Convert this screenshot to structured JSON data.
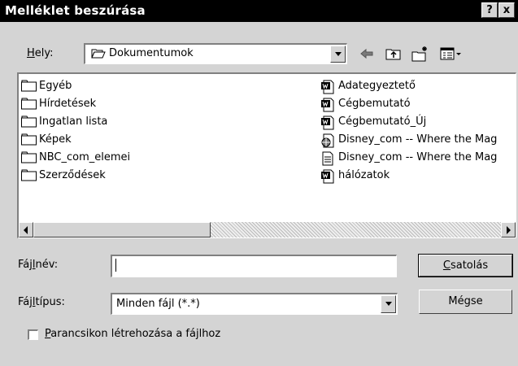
{
  "title": "Melléklet beszúrása",
  "title_buttons": {
    "help": "?",
    "close": "x"
  },
  "location": {
    "label_pre": "",
    "label_acc": "H",
    "label_post": "ely:",
    "value": "Dokumentumok"
  },
  "toolbar": {
    "back_icon": "arrow-left-icon",
    "up_icon": "up-folder-icon",
    "new_folder_icon": "new-folder-icon",
    "view_menu_icon": "view-menu-icon"
  },
  "files_left": [
    {
      "name": "Egyéb",
      "icon": "folder-icon"
    },
    {
      "name": "Hírdetések",
      "icon": "folder-icon"
    },
    {
      "name": "Ingatlan lista",
      "icon": "folder-icon"
    },
    {
      "name": "Képek",
      "icon": "folder-icon"
    },
    {
      "name": "NBC_com_elemei",
      "icon": "folder-icon"
    },
    {
      "name": "Szerződések",
      "icon": "folder-icon"
    }
  ],
  "files_right": [
    {
      "name": "Adategyeztető",
      "icon": "word-doc-icon"
    },
    {
      "name": "Cégbemutató",
      "icon": "word-doc-icon"
    },
    {
      "name": "Cégbemutató_Új",
      "icon": "word-doc-icon"
    },
    {
      "name": "Disney_com -- Where the Mag",
      "icon": "web-doc-icon"
    },
    {
      "name": "Disney_com -- Where the Mag",
      "icon": "text-doc-icon"
    },
    {
      "name": "hálózatok",
      "icon": "word-doc-icon"
    }
  ],
  "filename": {
    "label_pre": "Fáj",
    "label_acc": "l",
    "label_post": "név:",
    "value": ""
  },
  "filetype": {
    "label_pre": "Fáj",
    "label_acc": "l",
    "label_post": "típus:",
    "value": "Minden fájl (*.*)"
  },
  "buttons": {
    "attach_acc": "C",
    "attach_rest": "satolás",
    "cancel": "Mégse"
  },
  "shortcut": {
    "label_acc": "P",
    "label_rest": "arancsikon létrehozása a fájlhoz",
    "checked": false
  }
}
